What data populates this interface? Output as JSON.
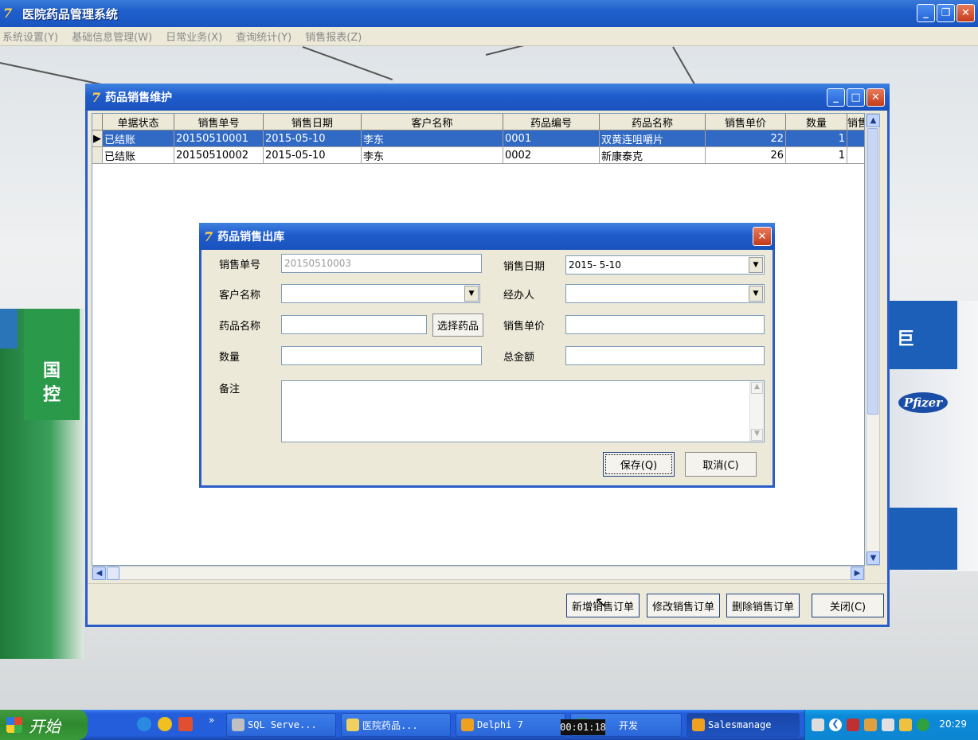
{
  "app": {
    "title": "医院药品管理系统",
    "menu": [
      "系统设置(Y)",
      "基础信息管理(W)",
      "日常业务(X)",
      "查询统计(Y)",
      "销售报表(Z)"
    ]
  },
  "background": {
    "sign_right": "巨",
    "sign_right_brand": "Pfizer",
    "sign_left_chars": [
      "国",
      "控"
    ]
  },
  "maint_window": {
    "title": "药品销售维护",
    "columns": [
      "单据状态",
      "销售单号",
      "销售日期",
      "客户名称",
      "药品编号",
      "药品名称",
      "销售单价",
      "数量",
      "销售金"
    ],
    "rows": [
      {
        "status": "已结账",
        "order_no": "20150510001",
        "date": "2015-05-10",
        "customer": "李东",
        "drug_no": "0001",
        "drug_name": "双黄连咀嚼片",
        "price": "22",
        "qty": "1"
      },
      {
        "status": "已结账",
        "order_no": "20150510002",
        "date": "2015-05-10",
        "customer": "李东",
        "drug_no": "0002",
        "drug_name": "新康泰克",
        "price": "26",
        "qty": "1"
      }
    ],
    "buttons": {
      "add": "新增销售订单",
      "edit": "修改销售订单",
      "delete": "删除销售订单",
      "close": "关闭(C)"
    }
  },
  "dialog": {
    "title": "药品销售出库",
    "labels": {
      "order_no": "销售单号",
      "sale_date": "销售日期",
      "customer": "客户名称",
      "handler": "经办人",
      "drug_name": "药品名称",
      "unit_price": "销售单价",
      "qty": "数量",
      "total": "总金额",
      "remark": "备注"
    },
    "values": {
      "order_no": "20150510003",
      "sale_date": "2015- 5-10",
      "customer": "",
      "handler": "",
      "drug_name": "",
      "unit_price": "",
      "qty": "",
      "total": "",
      "remark": ""
    },
    "select_drug_button": "选择药品",
    "save_button": "保存(Q)",
    "cancel_button": "取消(C)"
  },
  "taskbar": {
    "start": "开始",
    "items": [
      "SQL Serve...",
      "医院药品...",
      "Delphi 7",
      "开发",
      "Salesmanage"
    ],
    "clock": "20:29",
    "recording_timer": "00:01:18"
  }
}
